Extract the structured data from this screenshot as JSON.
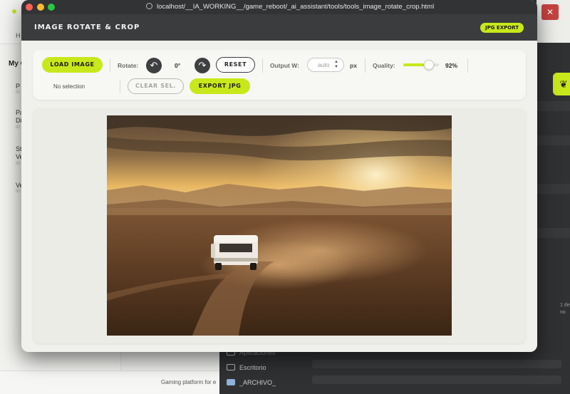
{
  "browser": {
    "url": "localhost/__IA_WORKING__/game_reboot/_ai_assistant/tools/tools_image_rotate_crop.html"
  },
  "app": {
    "title": "IMAGE ROTATE & CROP",
    "badge": "JPG EXPORT",
    "accent_color": "#c9e81b"
  },
  "toolbar": {
    "load_label": "LOAD IMAGE",
    "rotate_label": "Rotate:",
    "rotate_value": "0°",
    "reset_label": "RESET",
    "output_label": "Output W:",
    "width_value": "auto",
    "unit": "px",
    "quality_label": "Quality:",
    "quality_value": "92%",
    "quality_level": 0.72,
    "selection_status": "No selection",
    "clear_label": "CLEAR SEL.",
    "export_label": "EXPORT JPG",
    "rotate_left_icon": "rotate-left-icon",
    "rotate_right_icon": "rotate-right-icon"
  },
  "background_left": {
    "header_letter": "H",
    "section_title": "My G",
    "items": [
      {
        "label": "P",
        "sub": "ID"
      },
      {
        "label": "Pa",
        "label2": "Di",
        "sub": "ID"
      },
      {
        "label": "St",
        "label2": "Ve",
        "sub": "ID"
      },
      {
        "label": "Ve",
        "sub": "ID"
      }
    ],
    "footer": "Gaming platform for e"
  },
  "background_right": {
    "close": "✕",
    "side_text_1": "1 de",
    "side_text_2": "no",
    "finder_items": [
      "Aplicaciones",
      "Escritorio",
      "_ARCHIVO_"
    ]
  }
}
